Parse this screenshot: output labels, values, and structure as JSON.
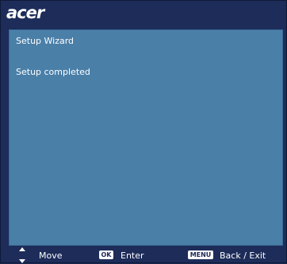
{
  "brand": {
    "logo_text": "acer"
  },
  "panel": {
    "title": "Setup Wizard",
    "message": "Setup completed"
  },
  "footer": {
    "move_icon": "up-down-arrows-icon",
    "move_label": "Move",
    "ok_key": "OK",
    "enter_label": "Enter",
    "menu_key": "MENU",
    "back_exit_label": "Back / Exit"
  },
  "colors": {
    "background": "#1d2c59",
    "panel": "#4a7fa8",
    "text": "#ffffff"
  }
}
